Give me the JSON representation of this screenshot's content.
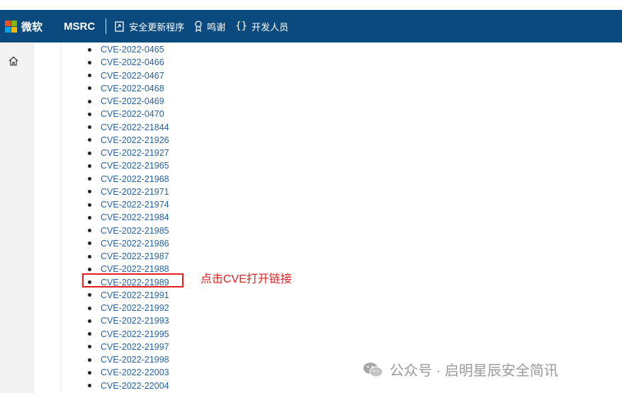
{
  "header": {
    "brand": "微软",
    "site": "MSRC",
    "nav": [
      {
        "label": "安全更新程序",
        "icon": "update-doc-icon"
      },
      {
        "label": "鸣谢",
        "icon": "award-ribbon-icon"
      },
      {
        "label": "开发人员",
        "icon": "code-braces-icon"
      }
    ]
  },
  "sidebar": {
    "home_icon": "home-icon"
  },
  "cve_list": [
    "CVE-2022-0465",
    "CVE-2022-0466",
    "CVE-2022-0467",
    "CVE-2022-0468",
    "CVE-2022-0469",
    "CVE-2022-0470",
    "CVE-2022-21844",
    "CVE-2022-21926",
    "CVE-2022-21927",
    "CVE-2022-21965",
    "CVE-2022-21968",
    "CVE-2022-21971",
    "CVE-2022-21974",
    "CVE-2022-21984",
    "CVE-2022-21985",
    "CVE-2022-21986",
    "CVE-2022-21987",
    "CVE-2022-21988",
    "CVE-2022-21989",
    "CVE-2022-21991",
    "CVE-2022-21992",
    "CVE-2022-21993",
    "CVE-2022-21995",
    "CVE-2022-21997",
    "CVE-2022-21998",
    "CVE-2022-22003",
    "CVE-2022-22004"
  ],
  "annotation": {
    "text": "点击CVE打开链接",
    "color": "#e02020"
  },
  "watermark": {
    "text": "公众号 · 启明星辰安全简讯"
  },
  "colors": {
    "header_bg": "#0a4a7e",
    "link": "#2563a6",
    "ms_logo": [
      "#f25022",
      "#7fba00",
      "#00a4ef",
      "#ffb900"
    ]
  }
}
